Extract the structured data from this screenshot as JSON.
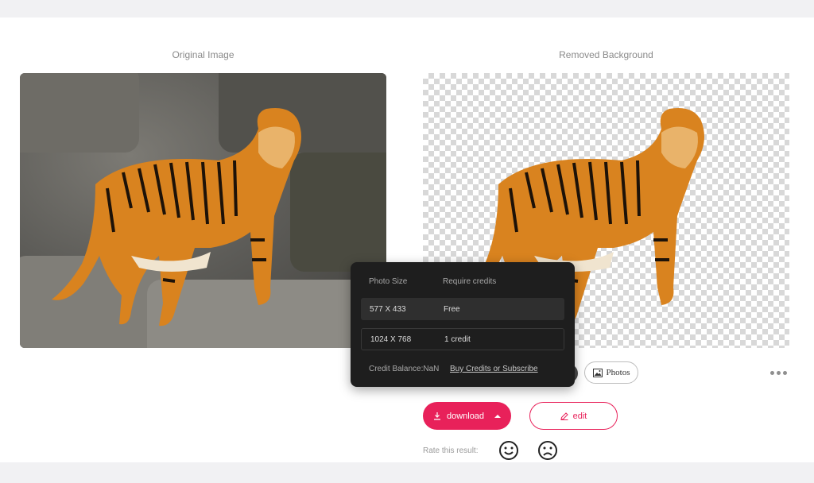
{
  "panels": {
    "original_title": "Original Image",
    "result_title": "Removed Background"
  },
  "toolbar": {
    "photos_label": "Photos",
    "colors": {
      "accent": "#e8215a",
      "popup_bg": "#1e1e1e"
    }
  },
  "actions": {
    "download_label": "download",
    "edit_label": "edit"
  },
  "rating": {
    "label": "Rate this result:"
  },
  "download_popup": {
    "header_size": "Photo Size",
    "header_credits": "Require credits",
    "options": [
      {
        "size": "577 X 433",
        "credits": "Free"
      },
      {
        "size": "1024 X 768",
        "credits": "1 credit"
      }
    ],
    "balance": "Credit Balance:NaN",
    "buy_link": "Buy Credits or Subscribe"
  }
}
